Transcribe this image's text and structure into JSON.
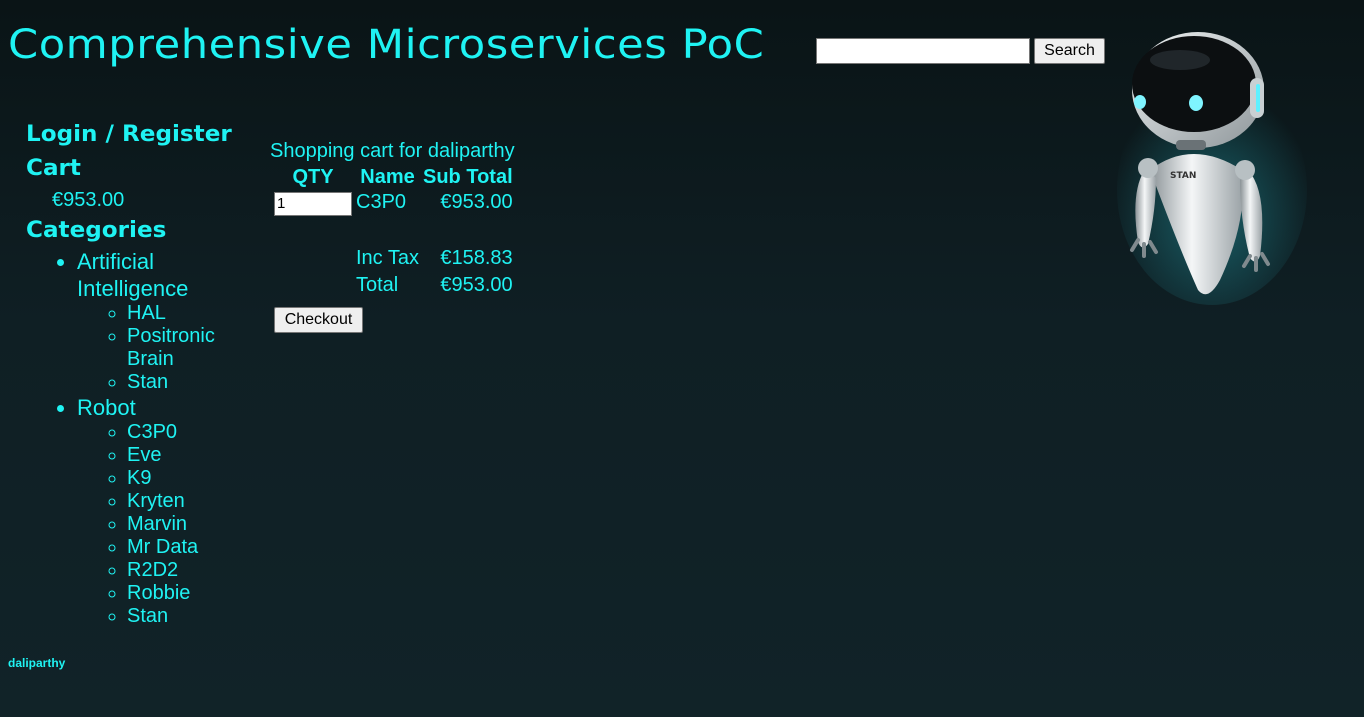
{
  "header": {
    "title": "Comprehensive Microservices PoC",
    "search_value": "",
    "search_button": "Search"
  },
  "sidebar": {
    "login": "Login / Register",
    "cart_heading": "Cart",
    "cart_total": "€953.00",
    "categories_heading": "Categories",
    "categories": [
      {
        "name": "Artificial Intelligence",
        "items": [
          "HAL",
          "Positronic Brain",
          "Stan"
        ]
      },
      {
        "name": "Robot",
        "items": [
          "C3P0",
          "Eve",
          "K9",
          "Kryten",
          "Marvin",
          "Mr Data",
          "R2D2",
          "Robbie",
          "Stan"
        ]
      }
    ]
  },
  "cart": {
    "caption": "Shopping cart for daliparthy",
    "columns": {
      "qty": "QTY",
      "name": "Name",
      "subtotal": "Sub Total"
    },
    "rows": [
      {
        "qty": "1",
        "name": "C3P0",
        "subtotal": "€953.00"
      }
    ],
    "tax_label": "Inc Tax",
    "tax_value": "€158.83",
    "total_label": "Total",
    "total_value": "€953.00",
    "checkout_button": "Checkout"
  },
  "footer": {
    "username": "daliparthy"
  },
  "mascot": {
    "label": "STAN",
    "icon": "robot-mascot-icon"
  },
  "colors": {
    "accent": "#1ff3f3",
    "background": "#0f1f24"
  }
}
